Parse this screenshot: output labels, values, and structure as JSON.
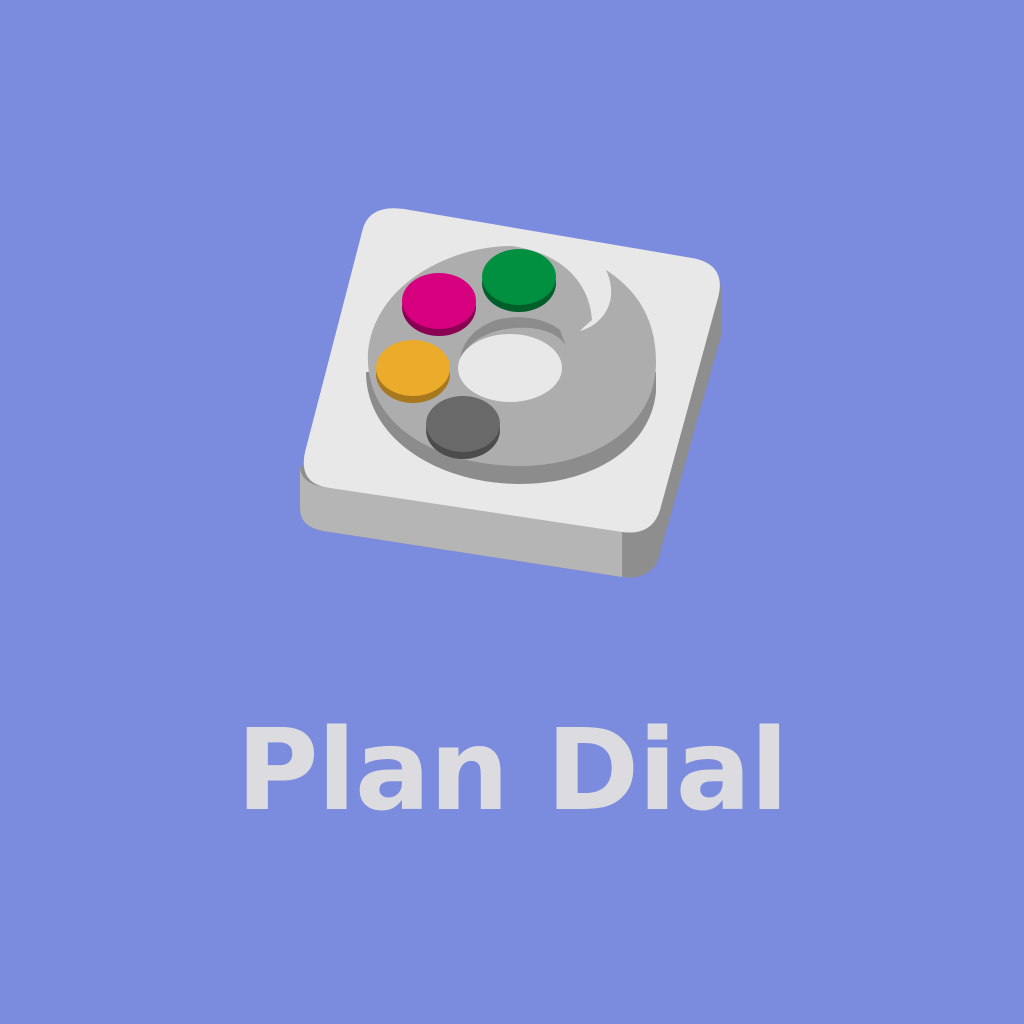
{
  "app": {
    "name": "Plan Dial"
  },
  "icon": {
    "name": "palette-icon",
    "colors": {
      "background": "#7b8bde",
      "tile_top": "#e8e8e8",
      "tile_side_light": "#b5b5b5",
      "tile_side_dark": "#8e8e8e",
      "palette_disc": "#adadad",
      "palette_hole": "#e8e8e8",
      "title_text": "#dcdce0"
    },
    "paint_swatches": [
      {
        "name": "magenta-swatch",
        "color": "#d6007e"
      },
      {
        "name": "green-swatch",
        "color": "#009040"
      },
      {
        "name": "yellow-swatch",
        "color": "#ebac2c"
      },
      {
        "name": "gray-swatch",
        "color": "#696969"
      }
    ]
  }
}
